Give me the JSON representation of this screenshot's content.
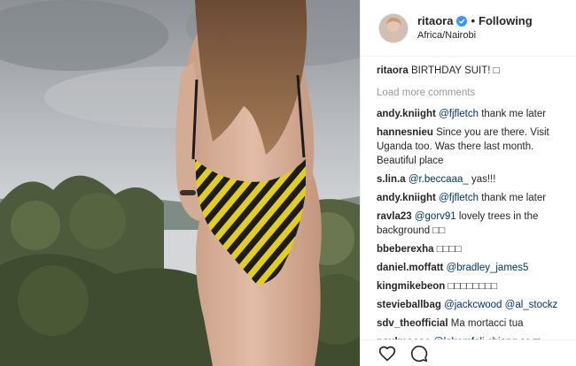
{
  "post": {
    "username": "ritaora",
    "separator": "•",
    "follow_label": "Following",
    "location": "Africa/Nairobi",
    "caption_user": "ritaora",
    "caption_text": "BIRTHDAY SUIT! □",
    "load_more": "Load more comments"
  },
  "comments": [
    {
      "user": "andy.kniight",
      "mention": "@fjfletch",
      "text": "thank me later"
    },
    {
      "user": "hannesnieu",
      "mention": "",
      "text": "Since you are there. Visit Uganda too. Was there last month. Beautiful place"
    },
    {
      "user": "s.lin.a",
      "mention": "@r.beccaaa_",
      "text": "yas!!!"
    },
    {
      "user": "andy.kniight",
      "mention": "@fjfletch",
      "text": "thank me later"
    },
    {
      "user": "ravla23",
      "mention": "@gorv91",
      "text": "lovely trees in the background □□"
    },
    {
      "user": "bbeberexha",
      "mention": "",
      "text": "□□□□"
    },
    {
      "user": "daniel.moffatt",
      "mention": "@bradley_james5",
      "text": ""
    },
    {
      "user": "kingmikebeon",
      "mention": "",
      "text": "□□□□□□□□"
    },
    {
      "user": "stevieballbag",
      "mention": "@jackcwood @al_stockz",
      "text": ""
    },
    {
      "user": "sdv_theofficial",
      "mention": "",
      "text": "Ma mortacci tua"
    },
    {
      "user": "paulmoose",
      "mention": "@lalremfeli",
      "text": "chiang sa □"
    }
  ],
  "colors": {
    "mention": "#003569",
    "verified": "#3897f0",
    "muted": "#999999"
  },
  "icons": [
    "heart-icon",
    "comment-icon",
    "verified-badge-icon"
  ]
}
